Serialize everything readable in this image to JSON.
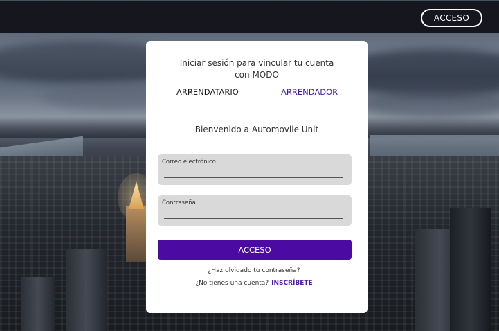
{
  "topbar": {
    "access_label": "ACCESO"
  },
  "card": {
    "title": "Iniciar sesión para vincular tu cuenta con MODO",
    "roles": {
      "tenant": "ARRENDATARIO",
      "landlord": "ARRENDADOR"
    },
    "welcome": {
      "prefix": "Bienvenido a",
      "brand": "Automovile Unit"
    },
    "email": {
      "label": "Correo electrónico",
      "value": ""
    },
    "password": {
      "label": "Contraseña",
      "value": ""
    },
    "submit_label": "ACCESO",
    "forgot_label": "¿Haz olvidado tu contraseña?",
    "signup": {
      "prompt": "¿No tienes una cuenta?",
      "link": "INSCRÍBETE"
    }
  },
  "colors": {
    "topbar_bg": "#16161f",
    "accent": "#4b0aa2",
    "landlord_text": "#4b1aa0",
    "field_bg": "#d9d9d9",
    "card_bg": "#ffffff"
  }
}
